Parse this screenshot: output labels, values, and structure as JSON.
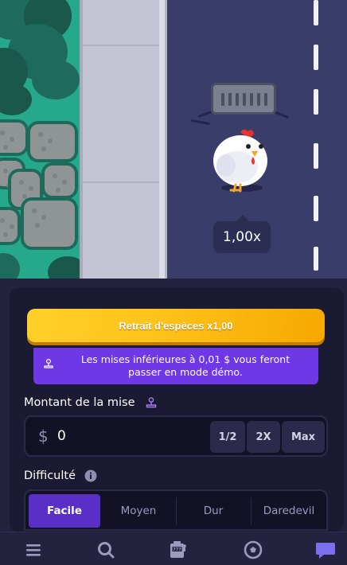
{
  "scene": {
    "multiplier_badge": "1,00x"
  },
  "controls": {
    "cashout_label": "Retrait d'espèces x1,00",
    "demo_notice": "Les mises inférieures à 0,01 $ vous feront passer en mode démo.",
    "bet": {
      "label": "Montant de la mise",
      "currency_symbol": "$",
      "value": "0",
      "buttons": [
        "1/2",
        "2X",
        "Max"
      ]
    },
    "difficulty": {
      "label": "Difficulté",
      "options": [
        "Facile",
        "Moyen",
        "Dur",
        "Daredevil"
      ],
      "selected": "Facile"
    }
  },
  "bottom_nav": {
    "items": [
      "menu-icon",
      "search-icon",
      "slot-machine-icon",
      "soccer-ball-icon",
      "chat-icon"
    ]
  },
  "colors": {
    "cashout": "#ffc21a",
    "demo_banner": "#7037e6",
    "difficulty_active": "#5a2fc8",
    "road": "#3a3d6a",
    "grass": "#26a98a"
  }
}
